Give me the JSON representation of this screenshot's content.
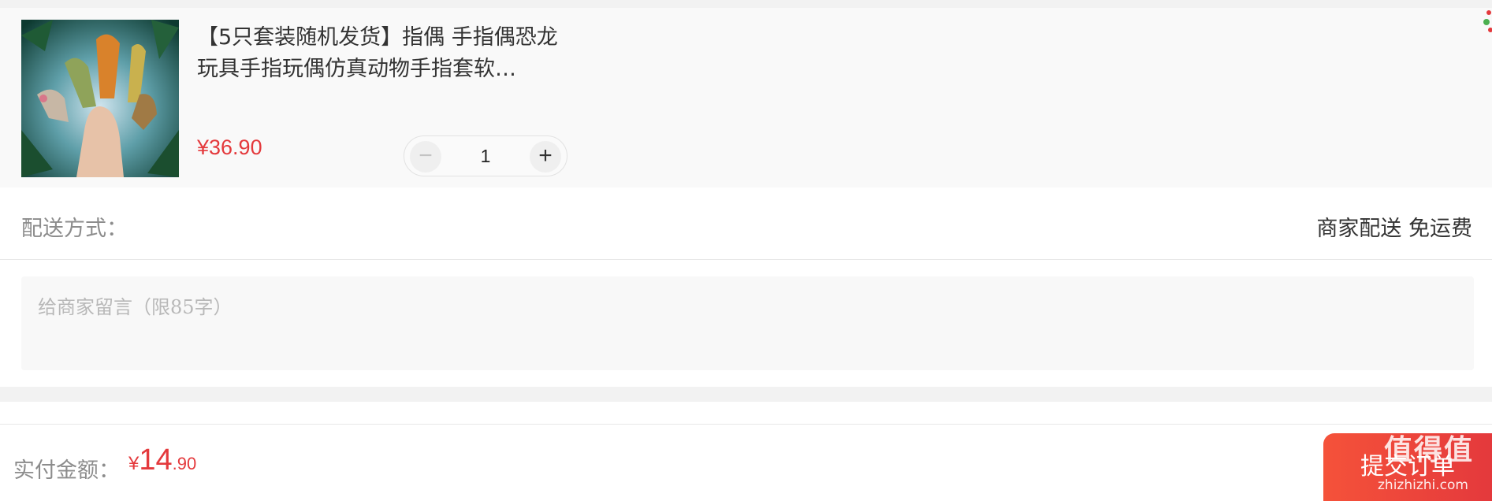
{
  "product": {
    "title": "【5只套装随机发货】指偶 手指偶恐龙玩具手指玩偶仿真动物手指套软…",
    "price": "¥36.90",
    "quantity": "1",
    "minus_symbol": "−",
    "plus_symbol": "+",
    "image_icon": "dinosaur-finger-puppet-photo"
  },
  "shipping": {
    "label": "配送方式：",
    "value": "商家配送  免运费"
  },
  "message": {
    "placeholder": "给商家留言（限85字）"
  },
  "footer": {
    "total_label": "实付金额：",
    "currency": "¥",
    "amount_int": "14",
    "amount_dec": ".90",
    "submit_label": "提交订单"
  },
  "watermark": {
    "brand": "值得值",
    "url": "zhizhizhi.com"
  },
  "colors": {
    "accent": "#e4393c",
    "card_bg": "#f9f9f9",
    "muted_text": "#8c8c8c"
  }
}
